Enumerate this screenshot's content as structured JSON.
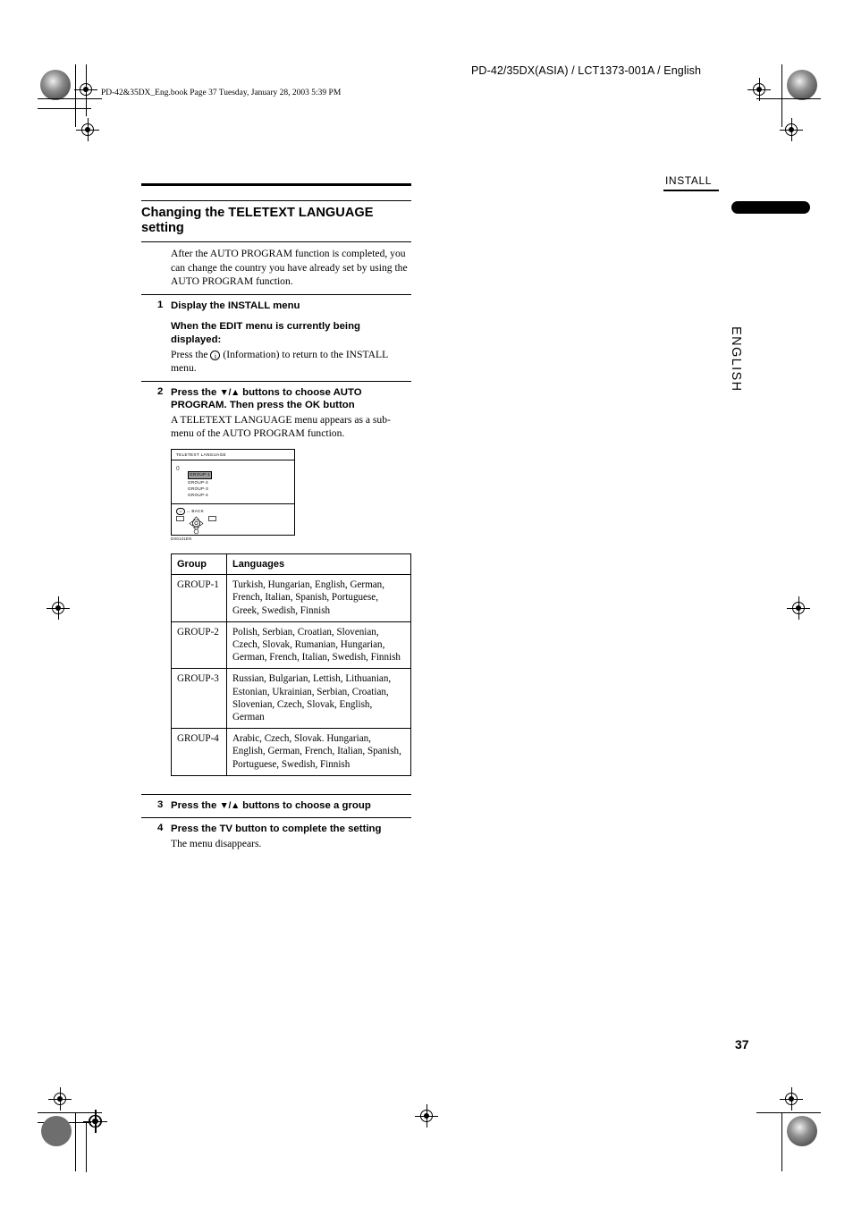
{
  "header": {
    "doc_id": "PD-42/35DX(ASIA) / LCT1373-001A / English",
    "book_line": "PD-42&35DX_Eng.book  Page 37  Tuesday, January 28, 2003  5:39 PM"
  },
  "margin": {
    "running_head": "INSTALL",
    "language_tab": "ENGLISH",
    "page_number": "37"
  },
  "main": {
    "section_title": "Changing the TELETEXT LANGUAGE setting",
    "intro": "After the AUTO PROGRAM function is completed, you can change the country you have already set by using the AUTO PROGRAM function.",
    "steps": [
      {
        "num": "1",
        "head": "Display the INSTALL menu",
        "sub": "When the EDIT menu is currently being displayed:",
        "body_pre": "Press the ",
        "icon": "i",
        "body_post": " (Information) to return to the INSTALL menu."
      },
      {
        "num": "2",
        "head_a": "Press the ",
        "head_arrows": "▼/▲",
        "head_b": " buttons to choose AUTO PROGRAM. Then press the ",
        "head_ok": "OK",
        "head_c": " button",
        "body": "A TELETEXT LANGUAGE menu appears as a sub-menu of the AUTO PROGRAM function."
      },
      {
        "num": "3",
        "head_a": "Press the ",
        "head_arrows": "▼/▲",
        "head_b": " buttons to choose a group"
      },
      {
        "num": "4",
        "head_a": "Press the ",
        "head_tv": "TV",
        "head_b": " button to complete the setting",
        "body": "The menu disappears."
      }
    ],
    "osd": {
      "title": "TELETEXT LANGUAGE",
      "cursor": "()",
      "options": [
        "GROUP-1",
        "GROUP-2",
        "GROUP-3",
        "GROUP-4"
      ],
      "selected": "GROUP-1",
      "back_button": "◎",
      "back_arrow": "←",
      "back_label": "BACK",
      "pad_left": "TV",
      "pad_right": "OK",
      "caption": "DX0131EN"
    },
    "table": {
      "headers": [
        "Group",
        "Languages"
      ],
      "rows": [
        {
          "group": "GROUP-1",
          "languages": "Turkish, Hungarian, English, German, French, Italian, Spanish, Portuguese, Greek, Swedish, Finnish"
        },
        {
          "group": "GROUP-2",
          "languages": "Polish, Serbian, Croatian, Slovenian, Czech, Slovak, Rumanian, Hungarian, German, French, Italian, Swedish, Finnish"
        },
        {
          "group": "GROUP-3",
          "languages": "Russian, Bulgarian, Lettish, Lithuanian, Estonian, Ukrainian, Serbian, Croatian, Slovenian, Czech, Slovak, English, German"
        },
        {
          "group": "GROUP-4",
          "languages": "Arabic, Czech, Slovak. Hungarian, English, German, French, Italian, Spanish, Portuguese, Swedish, Finnish"
        }
      ]
    }
  }
}
